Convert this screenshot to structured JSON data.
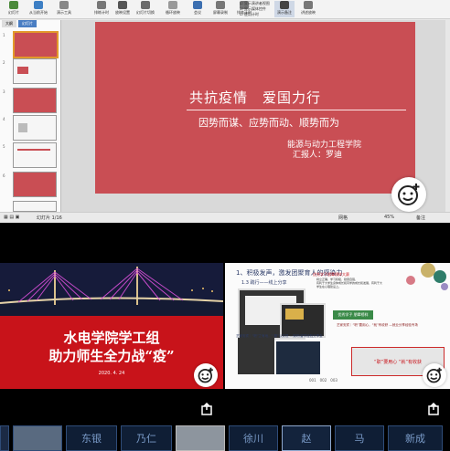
{
  "ppt": {
    "ribbon": [
      {
        "label": "幻灯片"
      },
      {
        "label": "从当前开始"
      },
      {
        "label": "演示工具"
      },
      {
        "label": "排练计时"
      },
      {
        "label": "放映设置"
      },
      {
        "label": "幻灯片切换"
      },
      {
        "label": "循环放映"
      },
      {
        "label": "会议"
      },
      {
        "label": "屏幕录制"
      },
      {
        "label": "排练计时"
      },
      {
        "label": "演示备注"
      },
      {
        "label": "讲述放映"
      }
    ],
    "ribbon_checks": [
      {
        "label": "显示演讲者视图"
      },
      {
        "label": "显示媒体控件"
      },
      {
        "label": "使用计时"
      }
    ],
    "panel_tabs": [
      {
        "label": "大纲"
      },
      {
        "label": "幻灯片"
      }
    ],
    "thumb_numbers": [
      "1",
      "2",
      "3",
      "4",
      "5",
      "6"
    ],
    "slide": {
      "title": "共抗疫情　爱国力行",
      "subtitle": "因势而谋、应势而动、顺势而为",
      "org": "能源与动力工程学院",
      "reporter": "汇报人：罗迪"
    },
    "status": {
      "left": "幻灯片 1/16",
      "theme": "网格",
      "zoom": "45%",
      "right": "备注"
    }
  },
  "card1": {
    "line1": "水电学院学工组",
    "line2": "助力师生全力战“疫”",
    "date": "2020. 4. 24"
  },
  "card2": {
    "title": "1、积极发声，激发团聚育人的感染力",
    "subtitle": "1.3 践行——线上分享",
    "heading": "优秀学子朋辈榜样大赛",
    "lines": [
      "树立正确、学习积极、勤奋自强，",
      "有利于大学生身体成长和同学的成长和发展，有利于大",
      "学生在心理建设上。"
    ],
    "badge1": "优秀学子 朋辈榜样",
    "badge2": "艺家安宾｜“职”要用心，“就”有收获 —就业分享经验专场",
    "badge3": "艺家安宾｜“职”之有地，“ 服”以实现 —保研/留学经验分享会",
    "banner": "“职”要用心 “就”有收获",
    "pages": [
      "001",
      "002",
      "003"
    ]
  },
  "strip": [
    {
      "label": ""
    },
    {
      "label": ""
    },
    {
      "label": "东银"
    },
    {
      "label": "乃仁"
    },
    {
      "label": ""
    },
    {
      "label": "徐川"
    },
    {
      "label": "赵"
    },
    {
      "label": "马"
    },
    {
      "label": "新成"
    }
  ],
  "colors": {
    "slide": "#c94e54",
    "banner": "#c8131a",
    "strip_border": "#2f4c78"
  }
}
